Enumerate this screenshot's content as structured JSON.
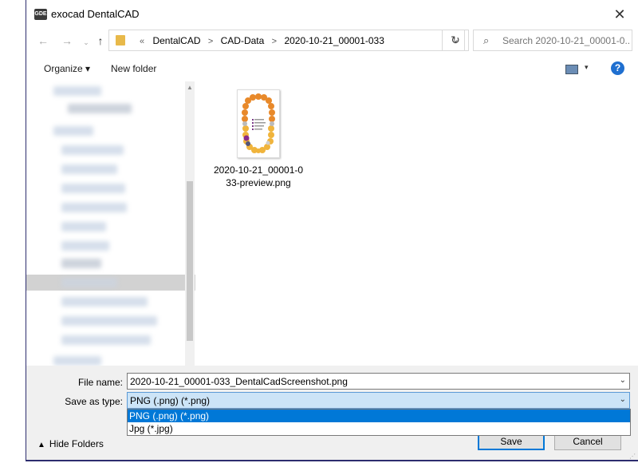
{
  "window": {
    "title": "exocad DentalCAD",
    "icon_text": "GDE"
  },
  "titlebar": {
    "close_glyph": "✕"
  },
  "nav": {
    "back_glyph": "←",
    "forward_glyph": "→",
    "up_glyph": "↑"
  },
  "address": {
    "prefix": "«",
    "crumbs": [
      "DentalCAD",
      "CAD-Data",
      "2020-10-21_00001-033"
    ],
    "separator": ">"
  },
  "search": {
    "placeholder": "Search 2020-10-21_00001-0..."
  },
  "toolbar": {
    "organize_label": "Organize ▾",
    "new_folder_label": "New folder",
    "help_label": "?"
  },
  "files": [
    {
      "name": "2020-10-21_00001-033-preview.png"
    }
  ],
  "form": {
    "file_name_label": "File name:",
    "file_name_value": "2020-10-21_00001-033_DentalCadScreenshot.png",
    "save_as_type_label": "Save as type:",
    "save_as_type_value": "PNG (.png) (*.png)",
    "type_options": [
      "PNG (.png) (*.png)",
      "Jpg (*.jpg)"
    ]
  },
  "footer": {
    "hide_folders_label": "Hide Folders",
    "save_label": "Save",
    "cancel_label": "Cancel"
  },
  "colors": {
    "accent": "#0078d7",
    "title_border": "#2d2d6e",
    "tooth_orange": "#e8892a",
    "tooth_yellow": "#f0b43c"
  }
}
